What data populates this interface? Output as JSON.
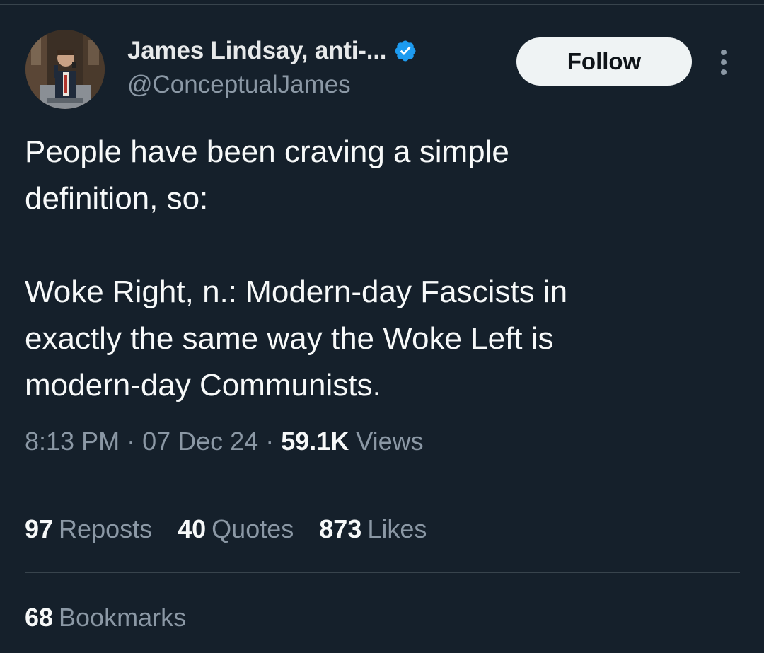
{
  "author": {
    "display_name": "James Lindsay, anti-...",
    "handle": "@ConceptualJames",
    "verified": true,
    "verified_color": "#1d9bf0"
  },
  "actions": {
    "follow_label": "Follow",
    "more_icon": "more-vertical-icon"
  },
  "tweet": {
    "text": "People have been craving a simple\ndefinition, so:\n\nWoke Right, n.: Modern-day Fascists in\nexactly the same way the Woke Left is\nmodern-day Communists.",
    "time": "8:13 PM",
    "date": "07 Dec 24",
    "separator": "·",
    "views_count": "59.1K",
    "views_label": "Views"
  },
  "stats": {
    "reposts_count": "97",
    "reposts_label": "Reposts",
    "quotes_count": "40",
    "quotes_label": "Quotes",
    "likes_count": "873",
    "likes_label": "Likes",
    "bookmarks_count": "68",
    "bookmarks_label": "Bookmarks"
  },
  "theme": {
    "background": "#15202b",
    "text_primary": "#f7f9f9",
    "text_secondary": "#8b98a5",
    "divider": "#38444d",
    "button_bg": "#eff3f4"
  }
}
